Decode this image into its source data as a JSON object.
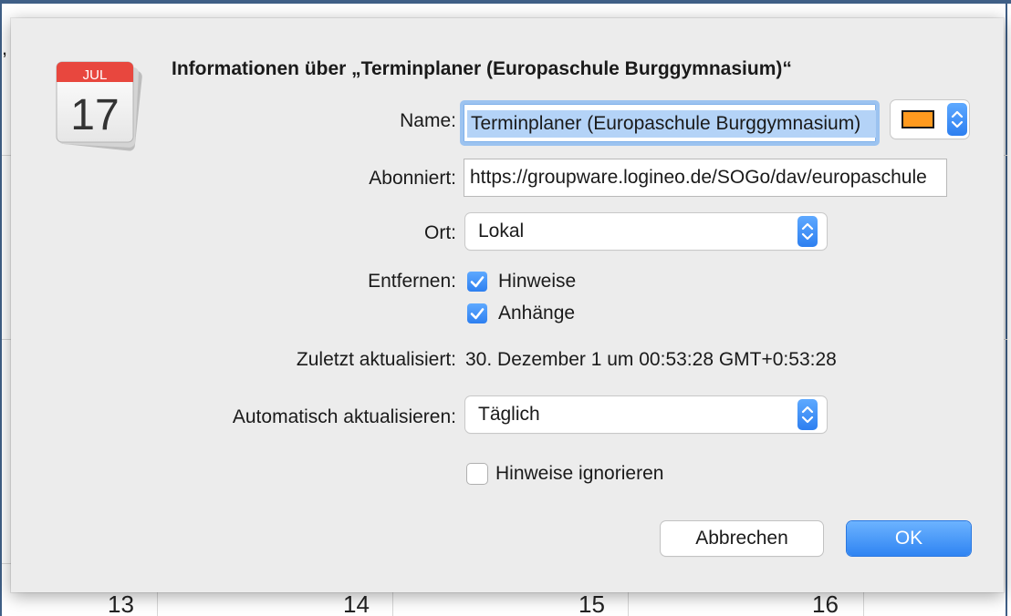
{
  "background": {
    "day_numbers": [
      "13",
      "14",
      "15",
      "16"
    ]
  },
  "icon": {
    "name": "calendar-app-icon",
    "month": "JUL",
    "day": "17"
  },
  "dialog": {
    "title": "Informationen über „Terminplaner (Europaschule Burggymnasium)“",
    "name_label": "Name:",
    "name_value": "Terminplaner (Europaschule Burggymnasium)",
    "color_accent": "#ff9a1f",
    "subscribed_label": "Abonniert:",
    "subscribed_value": "https://groupware.logineo.de/SOGo/dav/europaschule",
    "location_label": "Ort:",
    "location_value": "Lokal",
    "remove_label": "Entfernen:",
    "remove_alerts_label": "Hinweise",
    "remove_alerts_checked": true,
    "remove_attachments_label": "Anhänge",
    "remove_attachments_checked": true,
    "last_updated_label": "Zuletzt aktualisiert:",
    "last_updated_value": "30. Dezember 1 um 00:53:28 GMT+0:53:28",
    "auto_refresh_label": "Automatisch aktualisieren:",
    "auto_refresh_value": "Täglich",
    "ignore_alerts_label": "Hinweise ignorieren",
    "ignore_alerts_checked": false,
    "cancel_label": "Abbrechen",
    "ok_label": "OK"
  }
}
